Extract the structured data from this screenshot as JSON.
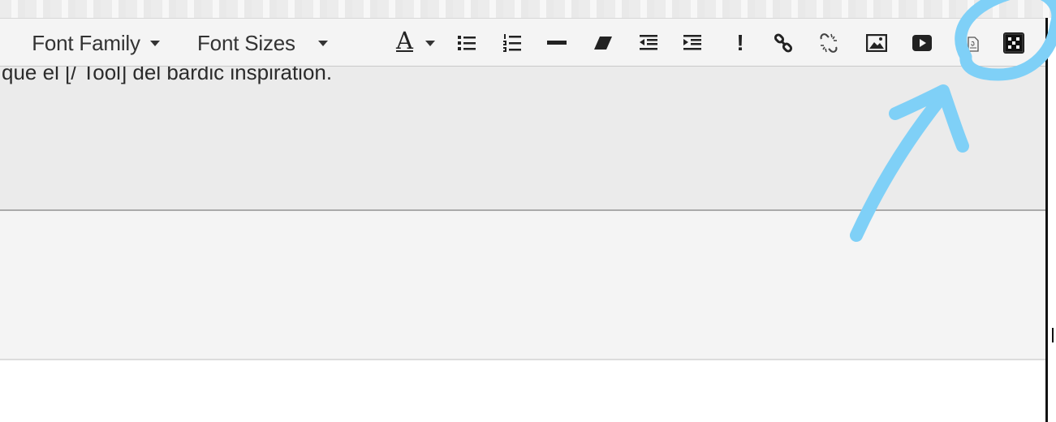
{
  "toolbar": {
    "font_family_label": "Font Family",
    "font_sizes_label": "Font Sizes",
    "text_color_letter": "A",
    "important_glyph": "!"
  },
  "editor": {
    "visible_text": "que el [/ Tool] del bardic inspiration."
  },
  "icons": [
    "font-family-dropdown",
    "font-sizes-dropdown",
    "text-color-icon",
    "bullet-list-icon",
    "numbered-list-icon",
    "horizontal-rule-icon",
    "eraser-icon",
    "outdent-icon",
    "indent-icon",
    "important-icon",
    "link-icon",
    "unlink-icon",
    "image-icon",
    "video-icon",
    "document-icon",
    "dice-icon"
  ],
  "annotation": {
    "color": "#7fd0f7",
    "target": "dice-icon"
  }
}
